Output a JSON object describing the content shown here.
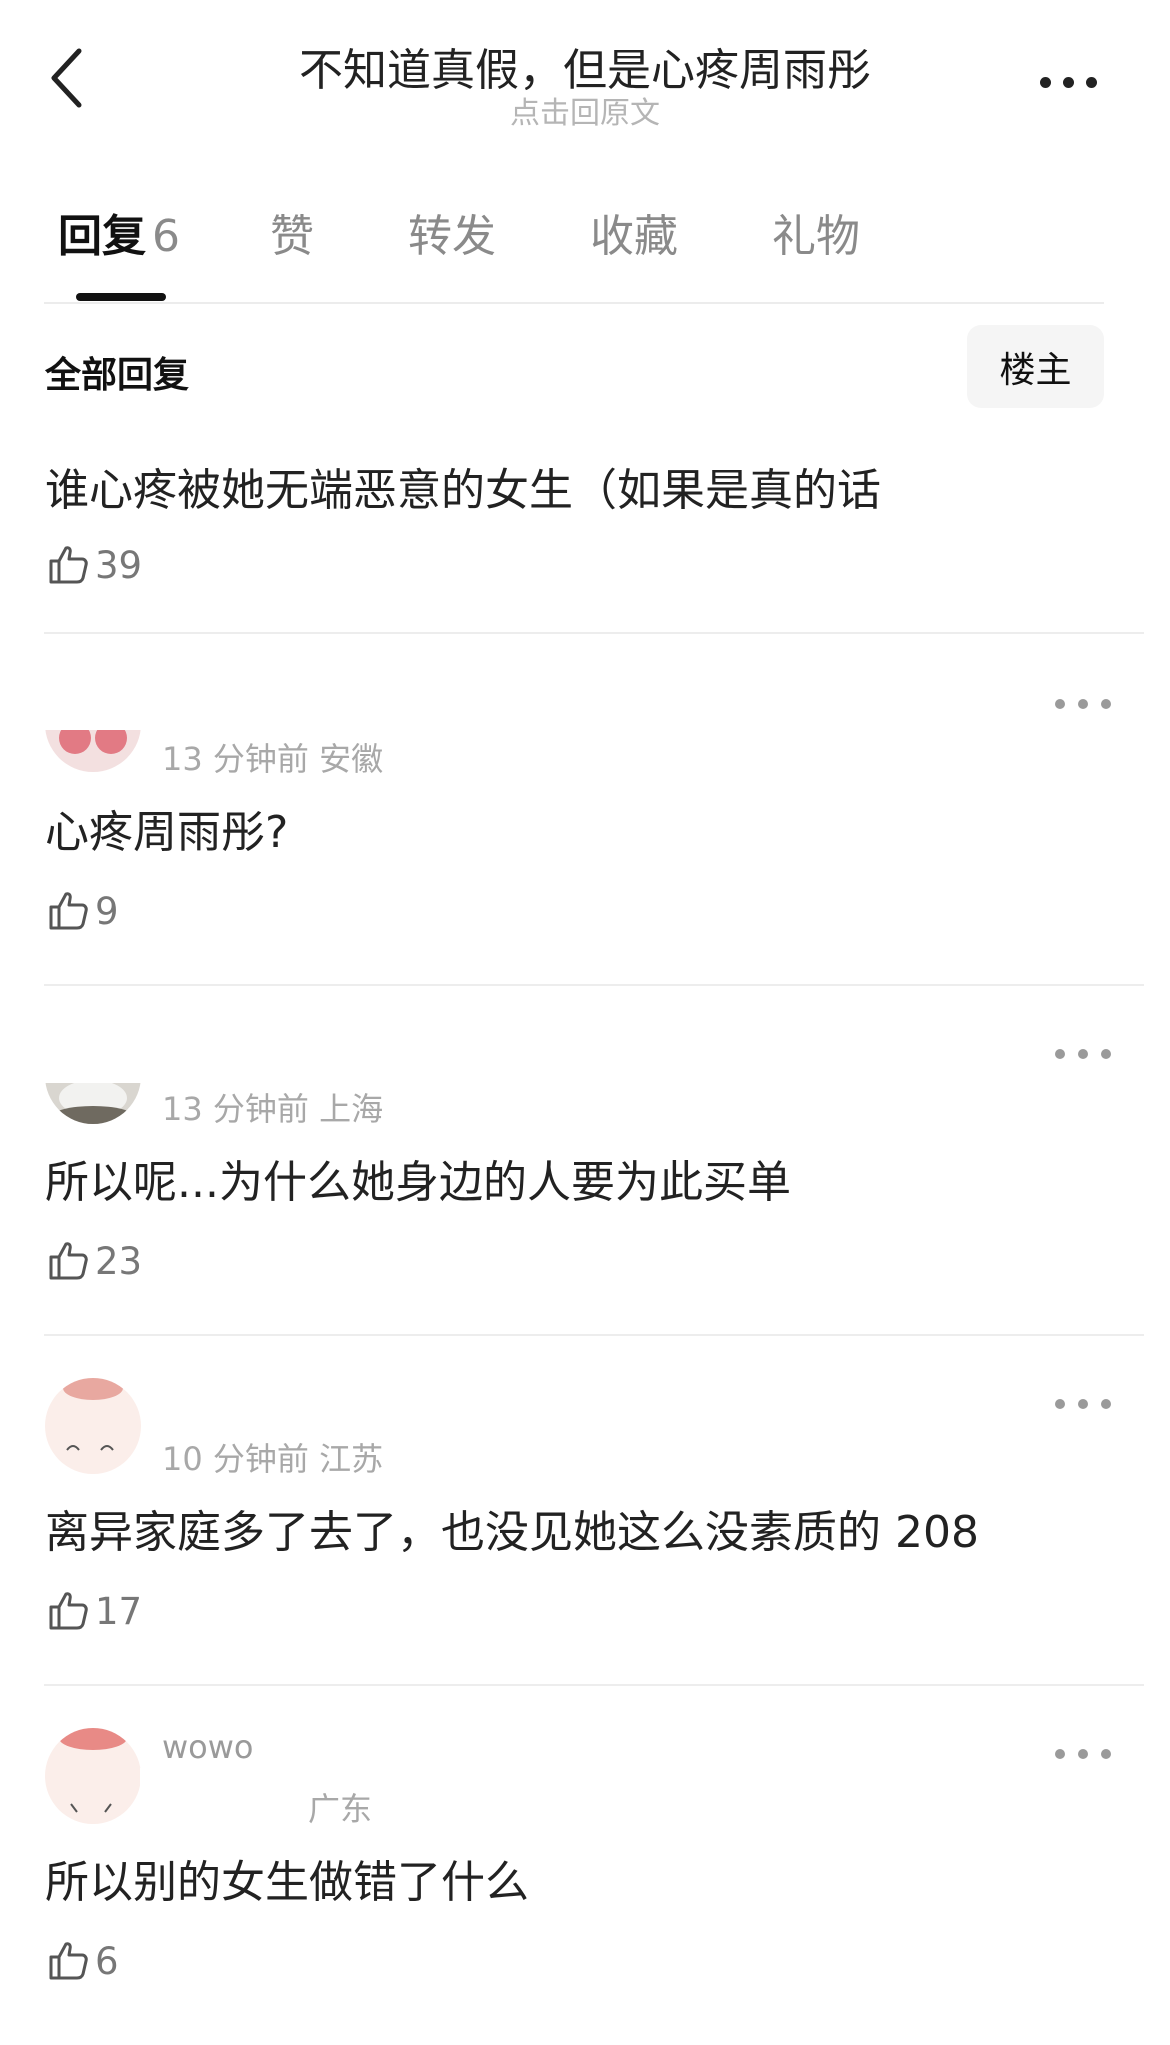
{
  "header": {
    "title": "不知道真假，但是心疼周雨彤",
    "subtitle": "点击回原文",
    "back_icon": "chevron-left-icon",
    "more_icon": "ellipsis-icon"
  },
  "tabs": [
    {
      "label": "回复",
      "count": "6",
      "active": true
    },
    {
      "label": "赞",
      "active": false
    },
    {
      "label": "转发",
      "active": false
    },
    {
      "label": "收藏",
      "active": false
    },
    {
      "label": "礼物",
      "active": false
    }
  ],
  "filter": {
    "label": "全部回复",
    "owner_button": "楼主"
  },
  "main_comment": {
    "text": "谁心疼被她无端恶意的女生（如果是真的话",
    "likes": "39"
  },
  "replies": [
    {
      "username": "",
      "time": "13 分钟前",
      "location": "安徽",
      "meta": "13 分钟前  安徽",
      "text": "心疼周雨彤?",
      "likes": "9"
    },
    {
      "username": "",
      "time": "13 分钟前",
      "location": "上海",
      "meta": "13 分钟前  上海",
      "text": "所以呢...为什么她身边的人要为此买单",
      "likes": "23"
    },
    {
      "username": "",
      "time": "10 分钟前",
      "location": "江苏",
      "meta": "10 分钟前  江苏",
      "text": "离异家庭多了去了，也没见她这么没素质的 208",
      "likes": "17"
    },
    {
      "username": "wowo",
      "time": "",
      "location": "广东",
      "meta": "广东",
      "text": "所以别的女生做错了什么",
      "likes": "6"
    }
  ],
  "colors": {
    "text_primary": "#222222",
    "text_secondary": "#8a8a8a",
    "meta": "#a8a8a8",
    "divider": "#ededed",
    "owner_button_bg": "#f5f5f5"
  }
}
